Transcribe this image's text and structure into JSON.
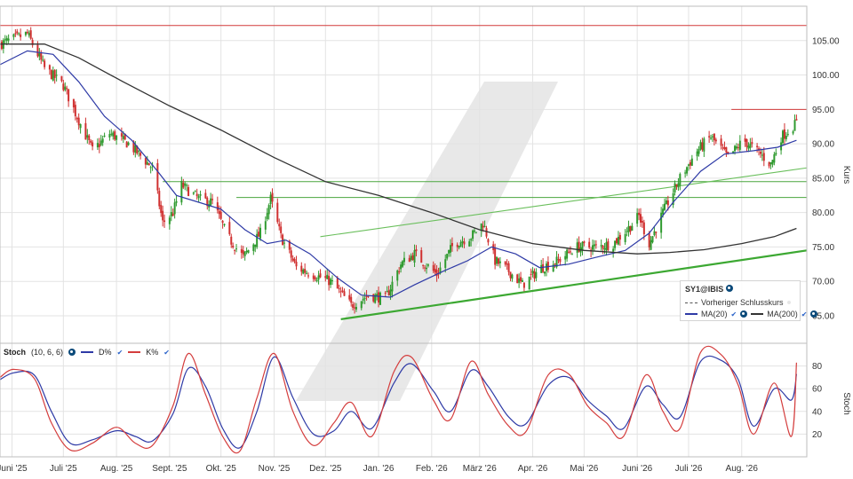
{
  "chart_data": [
    {
      "type": "candlestick",
      "instrument": "SY1@IBIS",
      "ylabel": "Kurs",
      "ylim": [
        61,
        110
      ],
      "yticks": [
        65,
        70,
        75,
        80,
        85,
        90,
        95,
        100,
        105
      ],
      "ytick_labels": [
        "65.00",
        "70.00",
        "75.00",
        "80.00",
        "85.00",
        "90.00",
        "95.00",
        "100.00",
        "105.00"
      ],
      "x_labels": [
        "Juni '25",
        "Juli '25",
        "Aug. '25",
        "Sept. '25",
        "Okt. '25",
        "Nov. '25",
        "Dez. '25",
        "Jan. '26",
        "Feb. '26",
        "März '26",
        "Apr. '26",
        "Mai '26",
        "Juni '26",
        "Juli '26",
        "Aug. '26"
      ],
      "x_dates": [
        "2025-06-01",
        "2025-07-01",
        "2025-08-01",
        "2025-09-01",
        "2025-10-01",
        "2025-11-01",
        "2025-12-01",
        "2026-01-01",
        "2026-02-01",
        "2026-03-01",
        "2026-04-01",
        "2026-05-01",
        "2026-06-01",
        "2026-07-01",
        "2026-08-01"
      ],
      "grid": true,
      "close_path": [
        [
          "2025-05-25",
          104.5
        ],
        [
          "2025-06-10",
          106.0
        ],
        [
          "2025-06-20",
          101.0
        ],
        [
          "2025-07-01",
          98.5
        ],
        [
          "2025-07-08",
          94.5
        ],
        [
          "2025-07-18",
          89.0
        ],
        [
          "2025-07-28",
          91.5
        ],
        [
          "2025-08-08",
          90.0
        ],
        [
          "2025-08-22",
          86.5
        ],
        [
          "2025-08-28",
          78.5
        ],
        [
          "2025-09-03",
          80.0
        ],
        [
          "2025-09-08",
          84.0
        ],
        [
          "2025-09-18",
          82.0
        ],
        [
          "2025-09-26",
          81.5
        ],
        [
          "2025-10-05",
          76.5
        ],
        [
          "2025-10-14",
          73.5
        ],
        [
          "2025-10-24",
          77.0
        ],
        [
          "2025-10-30",
          82.0
        ],
        [
          "2025-11-05",
          76.5
        ],
        [
          "2025-11-14",
          72.0
        ],
        [
          "2025-11-24",
          71.0
        ],
        [
          "2025-12-04",
          70.0
        ],
        [
          "2025-12-16",
          66.5
        ],
        [
          "2025-12-26",
          68.0
        ],
        [
          "2026-01-05",
          67.5
        ],
        [
          "2026-01-14",
          72.5
        ],
        [
          "2026-01-22",
          74.0
        ],
        [
          "2026-02-04",
          71.0
        ],
        [
          "2026-02-14",
          75.5
        ],
        [
          "2026-02-24",
          76.5
        ],
        [
          "2026-03-03",
          78.5
        ],
        [
          "2026-03-10",
          73.0
        ],
        [
          "2026-03-18",
          71.5
        ],
        [
          "2026-03-26",
          69.5
        ],
        [
          "2026-04-06",
          72.0
        ],
        [
          "2026-04-16",
          73.0
        ],
        [
          "2026-04-26",
          75.0
        ],
        [
          "2026-05-08",
          75.0
        ],
        [
          "2026-05-18",
          75.5
        ],
        [
          "2026-05-28",
          78.0
        ],
        [
          "2026-06-02",
          79.5
        ],
        [
          "2026-06-08",
          75.5
        ],
        [
          "2026-06-16",
          80.0
        ],
        [
          "2026-06-26",
          85.0
        ],
        [
          "2026-07-06",
          89.0
        ],
        [
          "2026-07-14",
          91.0
        ],
        [
          "2026-07-24",
          88.0
        ],
        [
          "2026-08-02",
          90.5
        ],
        [
          "2026-08-12",
          88.5
        ],
        [
          "2026-08-18",
          87.0
        ],
        [
          "2026-08-24",
          91.0
        ],
        [
          "2026-09-02",
          93.0
        ]
      ],
      "lines": [
        {
          "name": "MA(20)",
          "color": "#2e3aa6",
          "points": [
            [
              "2025-05-25",
              101.5
            ],
            [
              "2025-06-10",
              103.5
            ],
            [
              "2025-06-25",
              103.0
            ],
            [
              "2025-07-10",
              99.0
            ],
            [
              "2025-07-25",
              94.0
            ],
            [
              "2025-08-10",
              90.5
            ],
            [
              "2025-08-25",
              86.0
            ],
            [
              "2025-09-05",
              82.5
            ],
            [
              "2025-09-18",
              81.5
            ],
            [
              "2025-10-01",
              80.5
            ],
            [
              "2025-10-15",
              77.5
            ],
            [
              "2025-10-28",
              75.5
            ],
            [
              "2025-11-08",
              76.0
            ],
            [
              "2025-11-22",
              74.0
            ],
            [
              "2025-12-08",
              70.5
            ],
            [
              "2025-12-22",
              68.0
            ],
            [
              "2026-01-08",
              67.7
            ],
            [
              "2026-01-22",
              69.5
            ],
            [
              "2026-02-08",
              71.5
            ],
            [
              "2026-02-22",
              73.0
            ],
            [
              "2026-03-08",
              75.0
            ],
            [
              "2026-03-22",
              74.0
            ],
            [
              "2026-04-05",
              72.0
            ],
            [
              "2026-04-22",
              72.5
            ],
            [
              "2026-05-08",
              73.5
            ],
            [
              "2026-05-25",
              74.5
            ],
            [
              "2026-06-08",
              77.0
            ],
            [
              "2026-06-22",
              81.5
            ],
            [
              "2026-07-08",
              86.0
            ],
            [
              "2026-07-22",
              88.5
            ],
            [
              "2026-08-08",
              89.0
            ],
            [
              "2026-08-22",
              89.5
            ],
            [
              "2026-09-02",
              90.5
            ]
          ]
        },
        {
          "name": "MA(200)",
          "color": "#333333",
          "points": [
            [
              "2025-05-25",
              104.5
            ],
            [
              "2025-06-20",
              104.5
            ],
            [
              "2025-07-10",
              102.5
            ],
            [
              "2025-08-05",
              99.0
            ],
            [
              "2025-09-01",
              95.5
            ],
            [
              "2025-10-01",
              92.0
            ],
            [
              "2025-11-01",
              88.0
            ],
            [
              "2025-12-01",
              84.5
            ],
            [
              "2026-01-01",
              82.5
            ],
            [
              "2026-02-01",
              80.0
            ],
            [
              "2026-03-01",
              77.5
            ],
            [
              "2026-04-01",
              75.5
            ],
            [
              "2026-05-01",
              74.5
            ],
            [
              "2026-06-01",
              74.0
            ],
            [
              "2026-06-20",
              74.2
            ],
            [
              "2026-07-10",
              74.6
            ],
            [
              "2026-08-01",
              75.5
            ],
            [
              "2026-08-20",
              76.5
            ],
            [
              "2026-09-02",
              77.7
            ]
          ]
        }
      ],
      "reference_lines": [
        {
          "kind": "horizontal",
          "color": "#d23a3a",
          "y": 107.2,
          "from": "2025-05-25",
          "to": "2026-09-08"
        },
        {
          "kind": "horizontal",
          "color": "#d23a3a",
          "y": 95.0,
          "from": "2026-07-26",
          "to": "2026-09-08"
        },
        {
          "kind": "horizontal",
          "color": "#4aa63e",
          "y": 84.5,
          "from": "2025-08-28",
          "to": "2026-09-08"
        },
        {
          "kind": "horizontal",
          "color": "#4aa63e",
          "y": 82.2,
          "from": "2025-10-10",
          "to": "2026-09-08"
        },
        {
          "kind": "trend",
          "color": "#6abf5c",
          "from": [
            "2025-11-28",
            76.5
          ],
          "to": [
            "2026-09-08",
            86.5
          ]
        },
        {
          "kind": "trend",
          "color": "#3ca832",
          "from": [
            "2025-12-10",
            64.5
          ],
          "to": [
            "2026-09-08",
            74.5
          ]
        }
      ],
      "legend": {
        "title": "SY1@IBIS",
        "items": [
          "Vorheriger Schlusskurs",
          "MA(20)",
          "MA(200)"
        ],
        "placement": "lower-right"
      }
    },
    {
      "type": "line",
      "title": "Stoch",
      "params": "(10, 6, 6)",
      "ylabel": "Stoch",
      "ylim": [
        0,
        100
      ],
      "yticks": [
        20,
        40,
        60,
        80
      ],
      "ytick_labels": [
        "20",
        "40",
        "60",
        "80"
      ],
      "series": [
        {
          "name": "D%",
          "color": "#2e3aa6",
          "values": [
            [
              "2025-05-25",
              68
            ],
            [
              "2025-06-02",
              74
            ],
            [
              "2025-06-14",
              72
            ],
            [
              "2025-06-24",
              40
            ],
            [
              "2025-07-05",
              12
            ],
            [
              "2025-07-18",
              15
            ],
            [
              "2025-08-01",
              23
            ],
            [
              "2025-08-12",
              18
            ],
            [
              "2025-08-22",
              14
            ],
            [
              "2025-09-03",
              38
            ],
            [
              "2025-09-12",
              78
            ],
            [
              "2025-09-22",
              62
            ],
            [
              "2025-10-02",
              25
            ],
            [
              "2025-10-12",
              8
            ],
            [
              "2025-10-22",
              40
            ],
            [
              "2025-11-01",
              88
            ],
            [
              "2025-11-12",
              52
            ],
            [
              "2025-11-24",
              20
            ],
            [
              "2025-12-06",
              23
            ],
            [
              "2025-12-16",
              40
            ],
            [
              "2025-12-28",
              25
            ],
            [
              "2026-01-10",
              65
            ],
            [
              "2026-01-20",
              82
            ],
            [
              "2026-02-02",
              58
            ],
            [
              "2026-02-12",
              40
            ],
            [
              "2026-02-24",
              76
            ],
            [
              "2026-03-06",
              62
            ],
            [
              "2026-03-18",
              35
            ],
            [
              "2026-03-28",
              29
            ],
            [
              "2026-04-10",
              63
            ],
            [
              "2026-04-22",
              70
            ],
            [
              "2026-05-03",
              50
            ],
            [
              "2026-05-14",
              36
            ],
            [
              "2026-05-24",
              25
            ],
            [
              "2026-06-06",
              62
            ],
            [
              "2026-06-16",
              46
            ],
            [
              "2026-06-26",
              35
            ],
            [
              "2026-07-08",
              84
            ],
            [
              "2026-07-20",
              85
            ],
            [
              "2026-07-30",
              68
            ],
            [
              "2026-08-08",
              27
            ],
            [
              "2026-08-20",
              60
            ],
            [
              "2026-08-30",
              50
            ],
            [
              "2026-09-02",
              73
            ]
          ]
        },
        {
          "name": "K%",
          "color": "#d43d3d",
          "values": [
            [
              "2025-05-25",
              70
            ],
            [
              "2025-06-02",
              77
            ],
            [
              "2025-06-14",
              69
            ],
            [
              "2025-06-24",
              30
            ],
            [
              "2025-07-05",
              6
            ],
            [
              "2025-07-18",
              12
            ],
            [
              "2025-08-01",
              26
            ],
            [
              "2025-08-12",
              12
            ],
            [
              "2025-08-22",
              10
            ],
            [
              "2025-09-03",
              45
            ],
            [
              "2025-09-12",
              91
            ],
            [
              "2025-09-22",
              55
            ],
            [
              "2025-10-02",
              18
            ],
            [
              "2025-10-12",
              5
            ],
            [
              "2025-10-22",
              52
            ],
            [
              "2025-11-01",
              91
            ],
            [
              "2025-11-12",
              40
            ],
            [
              "2025-11-24",
              10
            ],
            [
              "2025-12-06",
              30
            ],
            [
              "2025-12-16",
              48
            ],
            [
              "2025-12-28",
              18
            ],
            [
              "2026-01-10",
              75
            ],
            [
              "2026-01-20",
              88
            ],
            [
              "2026-02-02",
              50
            ],
            [
              "2026-02-12",
              33
            ],
            [
              "2026-02-24",
              84
            ],
            [
              "2026-03-06",
              55
            ],
            [
              "2026-03-18",
              27
            ],
            [
              "2026-03-28",
              22
            ],
            [
              "2026-04-10",
              72
            ],
            [
              "2026-04-22",
              73
            ],
            [
              "2026-05-03",
              45
            ],
            [
              "2026-05-14",
              30
            ],
            [
              "2026-05-24",
              18
            ],
            [
              "2026-06-06",
              72
            ],
            [
              "2026-06-16",
              40
            ],
            [
              "2026-06-26",
              25
            ],
            [
              "2026-07-08",
              92
            ],
            [
              "2026-07-20",
              90
            ],
            [
              "2026-07-30",
              63
            ],
            [
              "2026-08-08",
              20
            ],
            [
              "2026-08-20",
              65
            ],
            [
              "2026-08-30",
              18
            ],
            [
              "2026-09-02",
              83
            ]
          ]
        }
      ],
      "legend": {
        "items": [
          "D%",
          "K%"
        ],
        "placement": "top-left"
      }
    }
  ]
}
